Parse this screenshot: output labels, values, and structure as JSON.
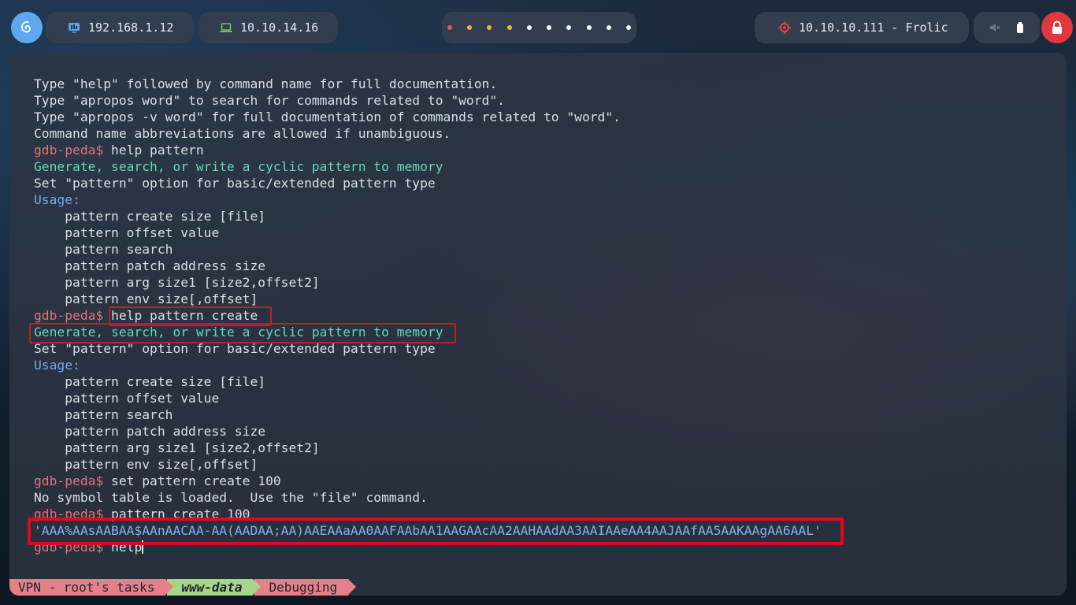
{
  "topbar": {
    "ip_local": "192.168.1.12",
    "ip_vpn": "10.10.14.16",
    "target": "10.10.10.111 - Frolic",
    "workspace_colors": [
      "#e05a5a",
      "#e8b43a",
      "#e8b43a",
      "#e8b43a",
      "#ffffff",
      "#ffffff",
      "#ffffff",
      "#ffffff",
      "#ffffff",
      "#ffffff"
    ],
    "icons": {
      "logo": "debian-swirl-icon",
      "local": "monitor-network-icon",
      "vpn": "laptop-icon",
      "target": "crosshair-target-icon",
      "volume": "volume-muted-icon",
      "battery": "battery-icon",
      "power": "lock-icon"
    }
  },
  "terminal": {
    "lines": [
      {
        "segs": [
          {
            "c": "text",
            "t": "Type \"help\" followed by command name for full documentation."
          }
        ]
      },
      {
        "segs": [
          {
            "c": "text",
            "t": "Type \"apropos word\" to search for commands related to \"word\"."
          }
        ]
      },
      {
        "segs": [
          {
            "c": "text",
            "t": "Type \"apropos -v word\" for full documentation of commands related to \"word\"."
          }
        ]
      },
      {
        "segs": [
          {
            "c": "text",
            "t": "Command name abbreviations are allowed if unambiguous."
          }
        ]
      },
      {
        "segs": [
          {
            "c": "prompt",
            "t": "gdb-peda$ "
          },
          {
            "c": "text",
            "t": "help pattern"
          }
        ]
      },
      {
        "segs": [
          {
            "c": "green",
            "t": "Generate, search, or write a cyclic pattern to memory"
          }
        ]
      },
      {
        "segs": [
          {
            "c": "text",
            "t": "Set \"pattern\" option for basic/extended pattern type"
          }
        ]
      },
      {
        "segs": [
          {
            "c": "blue",
            "t": "Usage:"
          }
        ]
      },
      {
        "segs": [
          {
            "c": "text",
            "t": "    pattern create size [file]"
          }
        ]
      },
      {
        "segs": [
          {
            "c": "text",
            "t": "    pattern offset value"
          }
        ]
      },
      {
        "segs": [
          {
            "c": "text",
            "t": "    pattern search"
          }
        ]
      },
      {
        "segs": [
          {
            "c": "text",
            "t": "    pattern patch address size"
          }
        ]
      },
      {
        "segs": [
          {
            "c": "text",
            "t": "    pattern arg size1 [size2,offset2]"
          }
        ]
      },
      {
        "segs": [
          {
            "c": "text",
            "t": "    pattern env size[,offset]"
          }
        ]
      },
      {
        "segs": [
          {
            "c": "prompt",
            "t": "gdb-peda$ "
          },
          {
            "c": "text",
            "t": "help pattern create"
          }
        ]
      },
      {
        "segs": [
          {
            "c": "green",
            "t": "Generate, search, or write a cyclic pattern to memory"
          }
        ]
      },
      {
        "segs": [
          {
            "c": "text",
            "t": "Set \"pattern\" option for basic/extended pattern type"
          }
        ]
      },
      {
        "segs": [
          {
            "c": "blue",
            "t": "Usage:"
          }
        ]
      },
      {
        "segs": [
          {
            "c": "text",
            "t": "    pattern create size [file]"
          }
        ]
      },
      {
        "segs": [
          {
            "c": "text",
            "t": "    pattern offset value"
          }
        ]
      },
      {
        "segs": [
          {
            "c": "text",
            "t": "    pattern search"
          }
        ]
      },
      {
        "segs": [
          {
            "c": "text",
            "t": "    pattern patch address size"
          }
        ]
      },
      {
        "segs": [
          {
            "c": "text",
            "t": "    pattern arg size1 [size2,offset2]"
          }
        ]
      },
      {
        "segs": [
          {
            "c": "text",
            "t": "    pattern env size[,offset]"
          }
        ]
      },
      {
        "segs": [
          {
            "c": "prompt",
            "t": "gdb-peda$ "
          },
          {
            "c": "text",
            "t": "set pattern create 100"
          }
        ]
      },
      {
        "segs": [
          {
            "c": "text",
            "t": "No symbol table is loaded.  Use the \"file\" command."
          }
        ]
      },
      {
        "segs": [
          {
            "c": "prompt",
            "t": "gdb-peda$ "
          },
          {
            "c": "text",
            "t": "pattern create 100"
          }
        ]
      },
      {
        "segs": [
          {
            "c": "str",
            "t": "'AAA%AAsAABAA$AAnAACAA-AA(AADAA;AA)AAEAAaAA0AAFAAbAA1AAGAAcAA2AAHAAdAA3AAIAAeAA4AAJAAfAA5AAKAAgAA6AAL'"
          }
        ]
      },
      {
        "segs": [
          {
            "c": "prompt",
            "t": "gdb-peda$ "
          },
          {
            "c": "text",
            "t": "help"
          }
        ],
        "cursor": true
      }
    ]
  },
  "statusbar": {
    "seg1": "VPN - root's tasks",
    "seg2": "www-data",
    "seg3": "Debugging"
  }
}
